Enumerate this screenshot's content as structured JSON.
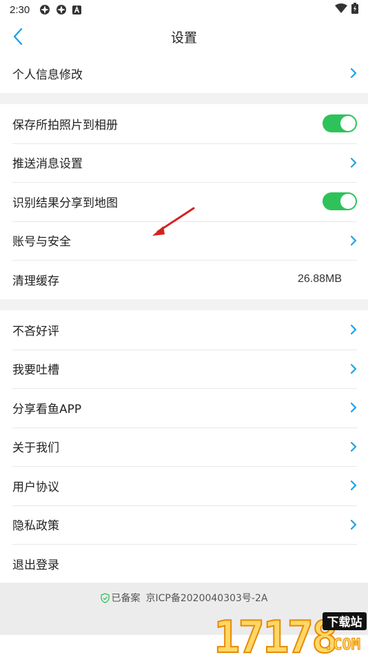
{
  "status_bar": {
    "time": "2:30"
  },
  "header": {
    "title": "设置"
  },
  "section1": {
    "items": [
      {
        "label": "个人信息修改"
      }
    ]
  },
  "section2": {
    "items": [
      {
        "label": "保存所拍照片到相册",
        "toggle": "on"
      },
      {
        "label": "推送消息设置"
      },
      {
        "label": "识别结果分享到地图",
        "toggle": "on"
      },
      {
        "label": "账号与安全"
      },
      {
        "label": "清理缓存",
        "value": "26.88MB"
      }
    ]
  },
  "section3": {
    "items": [
      {
        "label": "不吝好评"
      },
      {
        "label": "我要吐槽"
      },
      {
        "label": "分享看鱼APP"
      },
      {
        "label": "关于我们"
      },
      {
        "label": "用户协议"
      },
      {
        "label": "隐私政策"
      },
      {
        "label": "退出登录"
      }
    ]
  },
  "footer": {
    "filed": "已备案",
    "icp": "京ICP备2020040303号-2A"
  },
  "watermark": {
    "number": "17178",
    "tag": "下载站",
    "suffix": ".COM"
  },
  "colors": {
    "accent": "#1aa3e8",
    "toggle_on": "#2dc35a",
    "annotation": "#d42222"
  },
  "icons": {
    "back": "chevron-left-icon",
    "row": "chevron-right-icon",
    "footer": "shield-check-icon"
  }
}
